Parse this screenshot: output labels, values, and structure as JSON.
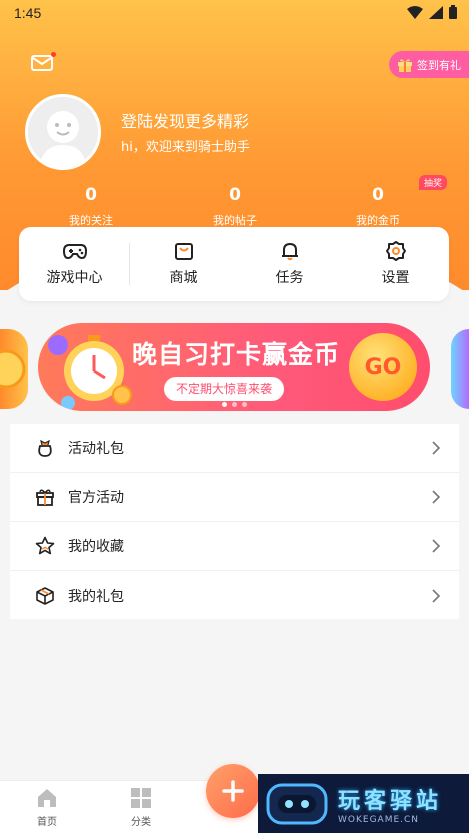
{
  "status_bar": {
    "time": "1:45"
  },
  "header": {
    "signin_label": "签到有礼",
    "login_title": "登陆发现更多精彩",
    "login_subtitle": "hi，欢迎来到骑士助手"
  },
  "stats": [
    {
      "value": "0",
      "label": "我的关注"
    },
    {
      "value": "0",
      "label": "我的帖子"
    },
    {
      "value": "0",
      "label": "我的金币"
    }
  ],
  "lottery_badge": "抽奖",
  "quick_menu": [
    {
      "label": "游戏中心",
      "icon": "gamepad-icon"
    },
    {
      "label": "商城",
      "icon": "shopping-bag-icon"
    },
    {
      "label": "任务",
      "icon": "bell-icon"
    },
    {
      "label": "设置",
      "icon": "gear-icon"
    }
  ],
  "banner": {
    "title": "晚自习打卡赢金币",
    "subtitle": "不定期大惊喜来袭",
    "cta": "GO",
    "page_count": 3,
    "active_page": 1
  },
  "list_items": [
    {
      "label": "活动礼包",
      "icon": "gift-bag-icon"
    },
    {
      "label": "官方活动",
      "icon": "gift-box-icon"
    },
    {
      "label": "我的收藏",
      "icon": "star-icon"
    },
    {
      "label": "我的礼包",
      "icon": "package-icon"
    }
  ],
  "tabbar": [
    {
      "label": "首页",
      "icon": "home-icon"
    },
    {
      "label": "分类",
      "icon": "grid-icon"
    }
  ],
  "watermark": {
    "title": "玩客驿站",
    "url": "WOKEGAME.CN"
  },
  "colors": {
    "accent": "#ff8a2c",
    "header_top": "#ffc24a",
    "pink": "#ff5da2"
  }
}
